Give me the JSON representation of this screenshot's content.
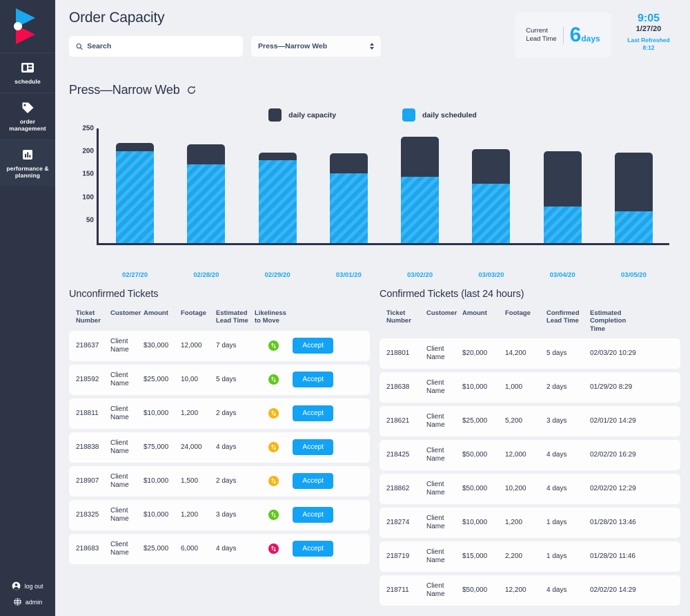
{
  "sidebar": {
    "logo_name": "play-logo",
    "items": [
      {
        "label": "schedule",
        "icon": "schedule-icon",
        "active": false
      },
      {
        "label": "order management",
        "icon": "tag-icon",
        "active": false
      },
      {
        "label": "performance & planning",
        "icon": "chart-icon",
        "active": true
      }
    ],
    "footer": [
      {
        "label": "log out",
        "icon": "user-icon"
      },
      {
        "label": "admin",
        "icon": "globe-icon"
      }
    ]
  },
  "header": {
    "title": "Order Capacity",
    "search": {
      "placeholder": "Search",
      "value": ""
    },
    "press_select": {
      "value": "Press—Narrow Web"
    },
    "lead_time": {
      "label_line1": "Current",
      "label_line2": "Lead Time",
      "value": "6",
      "unit": "days"
    },
    "clock": {
      "time": "9:05",
      "date": "1/27/20",
      "refreshed_label": "Last Refreshed",
      "refreshed_time": "8:12"
    }
  },
  "chart_panel": {
    "title": "Press—Narrow Web",
    "refresh_icon": "refresh-icon"
  },
  "chart_data": {
    "type": "bar",
    "title": "Press—Narrow Web",
    "stacked": true,
    "categories": [
      "02/27/20",
      "02/28/20",
      "02/29/20",
      "03/01/20",
      "03/02/20",
      "03/03/20",
      "03/04/20",
      "03/05/20"
    ],
    "series": [
      {
        "name": "daily scheduled",
        "color": "#19a7f0",
        "values": [
          200,
          172,
          180,
          152,
          145,
          130,
          80,
          70
        ]
      },
      {
        "name": "daily capacity",
        "color": "#333b4e",
        "values": [
          18,
          43,
          17,
          44,
          87,
          75,
          120,
          127
        ]
      }
    ],
    "totals": [
      218,
      215,
      197,
      196,
      232,
      205,
      200,
      197
    ],
    "legend": [
      "daily capacity",
      "daily scheduled"
    ],
    "legend_position": "top-center",
    "xlabel": "",
    "ylabel": "",
    "yticks": [
      50,
      100,
      150,
      200,
      250
    ],
    "ylim": [
      0,
      250
    ],
    "grid": false
  },
  "unconfirmed": {
    "title": "Unconfirmed Tickets",
    "columns": [
      "Ticket Number",
      "Customer",
      "Amount",
      "Footage",
      "Estimated Lead Time",
      "Likeliness to Move",
      ""
    ],
    "action_label": "Accept",
    "rows": [
      {
        "ticket": "218637",
        "customer": "Client Name",
        "amount": "$30,000",
        "footage": "12,000",
        "lead": "7 days",
        "likeliness": "green"
      },
      {
        "ticket": "218592",
        "customer": "Client Name",
        "amount": "$25,000",
        "footage": "10,00",
        "lead": "5 days",
        "likeliness": "green"
      },
      {
        "ticket": "218811",
        "customer": "Client Name",
        "amount": "$10,000",
        "footage": "1,200",
        "lead": "2 days",
        "likeliness": "yellow"
      },
      {
        "ticket": "218838",
        "customer": "Client Name",
        "amount": "$75,000",
        "footage": "24,000",
        "lead": "4 days",
        "likeliness": "yellow"
      },
      {
        "ticket": "218907",
        "customer": "Client Name",
        "amount": "$10,000",
        "footage": "1,500",
        "lead": "2 days",
        "likeliness": "yellow"
      },
      {
        "ticket": "218325",
        "customer": "Client Name",
        "amount": "$10,000",
        "footage": "1,200",
        "lead": "3 days",
        "likeliness": "green"
      },
      {
        "ticket": "218683",
        "customer": "Client Name",
        "amount": "$25,000",
        "footage": "6,000",
        "lead": "4 days",
        "likeliness": "red"
      }
    ]
  },
  "confirmed": {
    "title": "Confirmed Tickets (last 24 hours)",
    "columns": [
      "Ticket Number",
      "Customer",
      "Amount",
      "Footage",
      "Confirmed Lead Time",
      "Estimated Completion Time"
    ],
    "rows": [
      {
        "ticket": "218801",
        "customer": "Client Name",
        "amount": "$20,000",
        "footage": "14,200",
        "lead": "5 days",
        "completion": "02/03/20 10:29"
      },
      {
        "ticket": "218638",
        "customer": "Client Name",
        "amount": "$10,000",
        "footage": "1,000",
        "lead": "2 days",
        "completion": "01/29/20 8:29"
      },
      {
        "ticket": "218621",
        "customer": "Client Name",
        "amount": "$25,000",
        "footage": "5,200",
        "lead": "3 days",
        "completion": "02/01/20 14:29"
      },
      {
        "ticket": "218425",
        "customer": "Client Name",
        "amount": "$50,000",
        "footage": "12,000",
        "lead": "4 days",
        "completion": "02/02/20 16:29"
      },
      {
        "ticket": "218862",
        "customer": "Client Name",
        "amount": "$50,000",
        "footage": "10,200",
        "lead": "4 days",
        "completion": "02/02/20 12:29"
      },
      {
        "ticket": "218274",
        "customer": "Client Name",
        "amount": "$10,000",
        "footage": "1,200",
        "lead": "1 days",
        "completion": "01/28/20 13:46"
      },
      {
        "ticket": "218719",
        "customer": "Client Name",
        "amount": "$15,000",
        "footage": "2,200",
        "lead": "1 days",
        "completion": "01/28/20 11:46"
      },
      {
        "ticket": "218711",
        "customer": "Client Name",
        "amount": "$50,000",
        "footage": "12,200",
        "lead": "4 days",
        "completion": "02/02/20 14:29"
      }
    ]
  },
  "colors": {
    "accent_blue": "#19a7f0",
    "dark_navy": "#2e3546",
    "bar_dark": "#333b4e",
    "button_blue": "#12a3f5",
    "page_bg": "#eef0f4",
    "badge_green": "#5ec91b",
    "badge_yellow": "#f5b512",
    "badge_red": "#e8125f"
  }
}
